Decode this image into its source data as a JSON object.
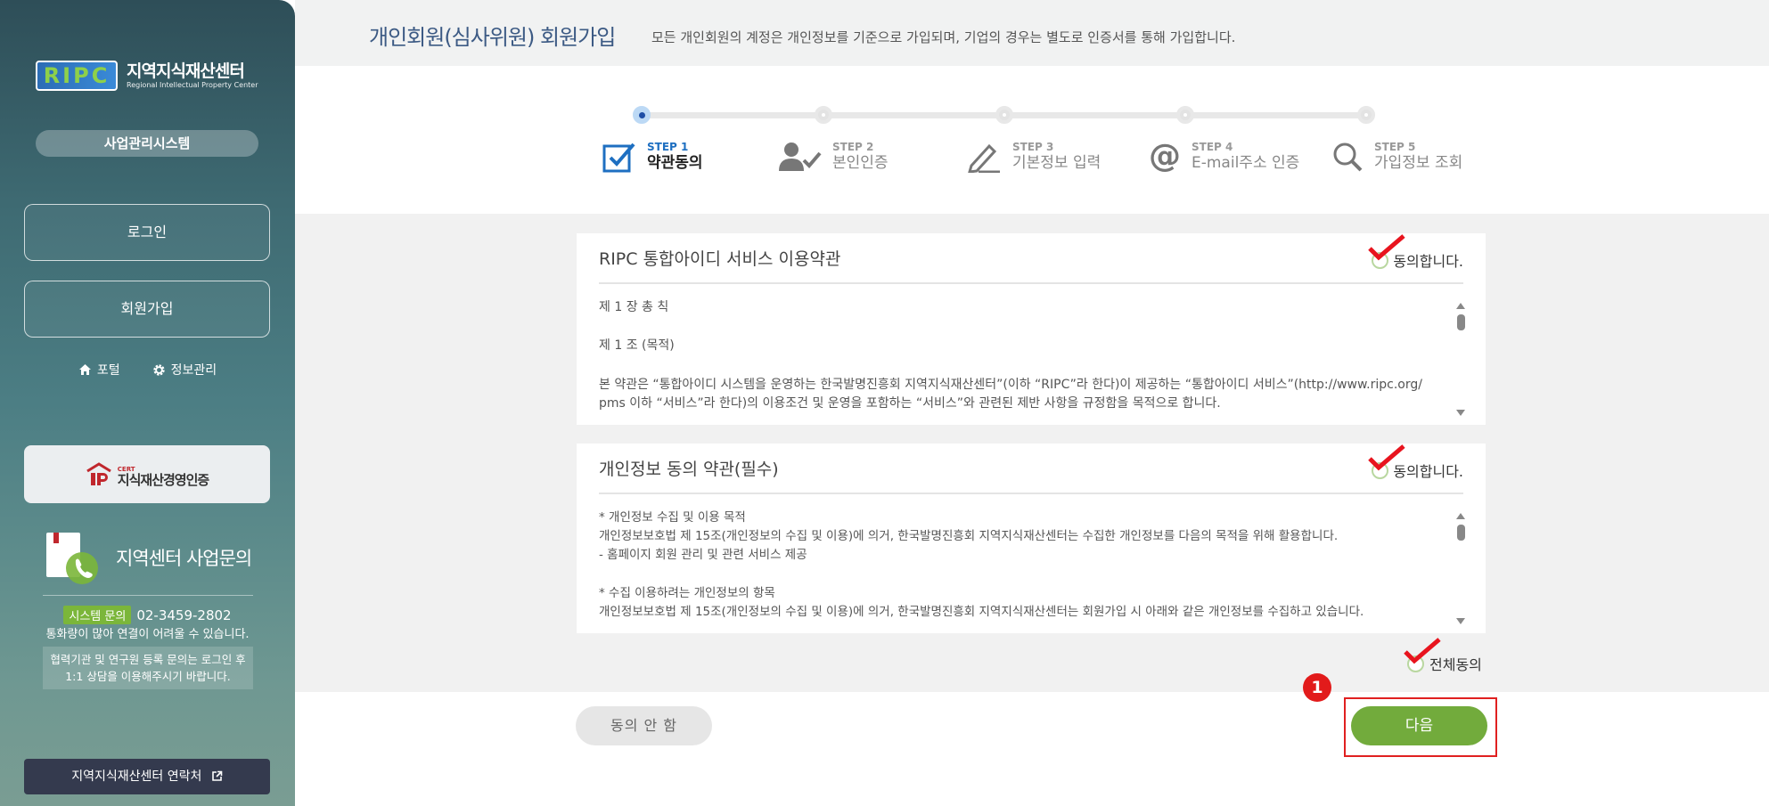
{
  "header": {
    "title": "개인회원(심사위원) 회원가입",
    "description": "모든 개인회원의 계정은 개인정보를 기준으로 가입되며, 기업의 경우는 별도로 인증서를 통해 가입합니다."
  },
  "sidebar": {
    "logo_mark": "RIPC",
    "logo_name": "지역지식재산센터",
    "logo_subtitle": "Regional Intellectual Property Center",
    "system_label": "사업관리시스템",
    "login_label": "로그인",
    "signup_label": "회원가입",
    "portal_label": "포털",
    "info_label": "정보관리",
    "cert_small": "CERT",
    "cert_label": "지식재산경영인증",
    "inquiry_title": "지역센터 사업문의",
    "system_inquiry_badge": "시스템 문의",
    "phone": "02-3459-2802",
    "busy_note": "통화량이 많아 연결이 어려울 수 있습니다.",
    "coop_note_1": "협력기관 및 연구원 등록 문의는 로그인 후",
    "coop_note_2": "1:1 상담을 이용해주시기 바랍니다.",
    "contact_label": "지역지식재산센터 연락처"
  },
  "steps": [
    {
      "no": "STEP 1",
      "name": "약관동의"
    },
    {
      "no": "STEP 2",
      "name": "본인인증"
    },
    {
      "no": "STEP 3",
      "name": "기본정보 입력"
    },
    {
      "no": "STEP 4",
      "name": "E-mail주소 인증"
    },
    {
      "no": "STEP 5",
      "name": "가입정보 조회"
    }
  ],
  "terms": {
    "title": "RIPC 통합아이디 서비스 이용약관",
    "agree_label": "동의합니다.",
    "chapter": "제 1 장 총 칙",
    "article": "제 1 조 (목적)",
    "para_1": "본 약관은 “통합아이디 시스템을 운영하는 한국발명진흥회 지역지식재산센터”(이하 “RIPC”라 한다)이 제공하는 “통합아이디 서비스”(http://www.ripc.org/",
    "para_2": "pms 이하 “서비스”라 한다)의 이용조건 및 운영을 포함하는 “서비스”와 관련된 제반 사항을 규정함을 목적으로 합니다."
  },
  "privacy": {
    "title": "개인정보 동의 약관(필수)",
    "agree_label": "동의합니다.",
    "line_1": "* 개인정보 수집 및 이용 목적",
    "line_2": "개인정보보호법 제 15조(개인정보의 수집 및 이용)에 의거, 한국발명진흥회 지역지식재산센터는 수집한 개인정보를 다음의 목적을 위해 활용합니다.",
    "line_3": "- 홈페이지 회원 관리 및 관련 서비스 제공",
    "line_4": "* 수집 이용하려는 개인정보의 항목",
    "line_5": "개인정보보호법 제 15조(개인정보의 수집 및 이용)에 의거, 한국발명진흥회 지역지식재산센터는 회원가입 시 아래와 같은 개인정보를 수집하고 있습니다."
  },
  "actions": {
    "all_agree_label": "전체동의",
    "disagree_label": "동의 안 함",
    "next_label": "다음",
    "callout_number": "1"
  },
  "colors": {
    "accent_green": "#72ab3c",
    "check_red": "#e8141e",
    "title_blue": "#3c5a84",
    "highlight_red": "#e02020"
  }
}
